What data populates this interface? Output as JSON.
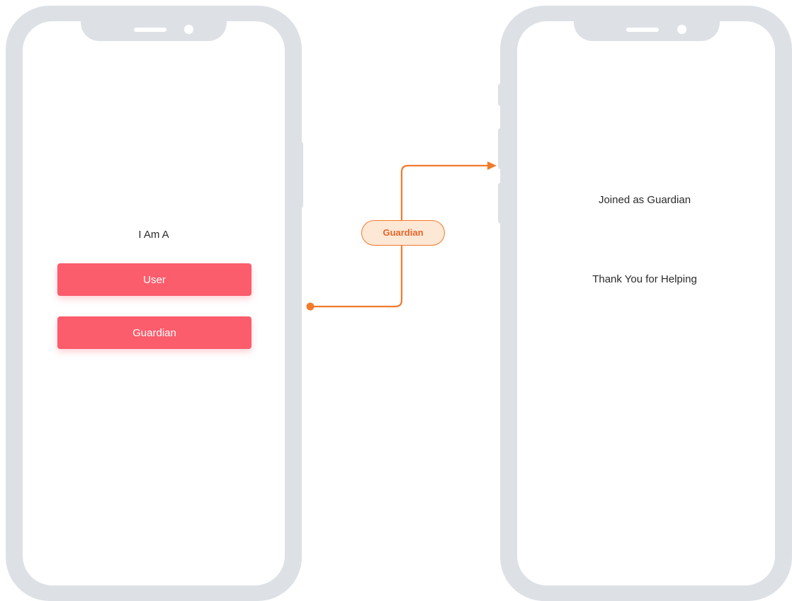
{
  "screen_left": {
    "heading": "I Am A",
    "buttons": [
      {
        "label": "User"
      },
      {
        "label": "Guardian"
      }
    ]
  },
  "flow": {
    "label": "Guardian"
  },
  "screen_right": {
    "line1": "Joined as Guardian",
    "line2": "Thank You for Helping"
  },
  "colors": {
    "device_frame": "#dde1e6",
    "button": "#fb5d6c",
    "flow_line": "#f27a2c",
    "flow_label_bg": "#fde7d5"
  }
}
